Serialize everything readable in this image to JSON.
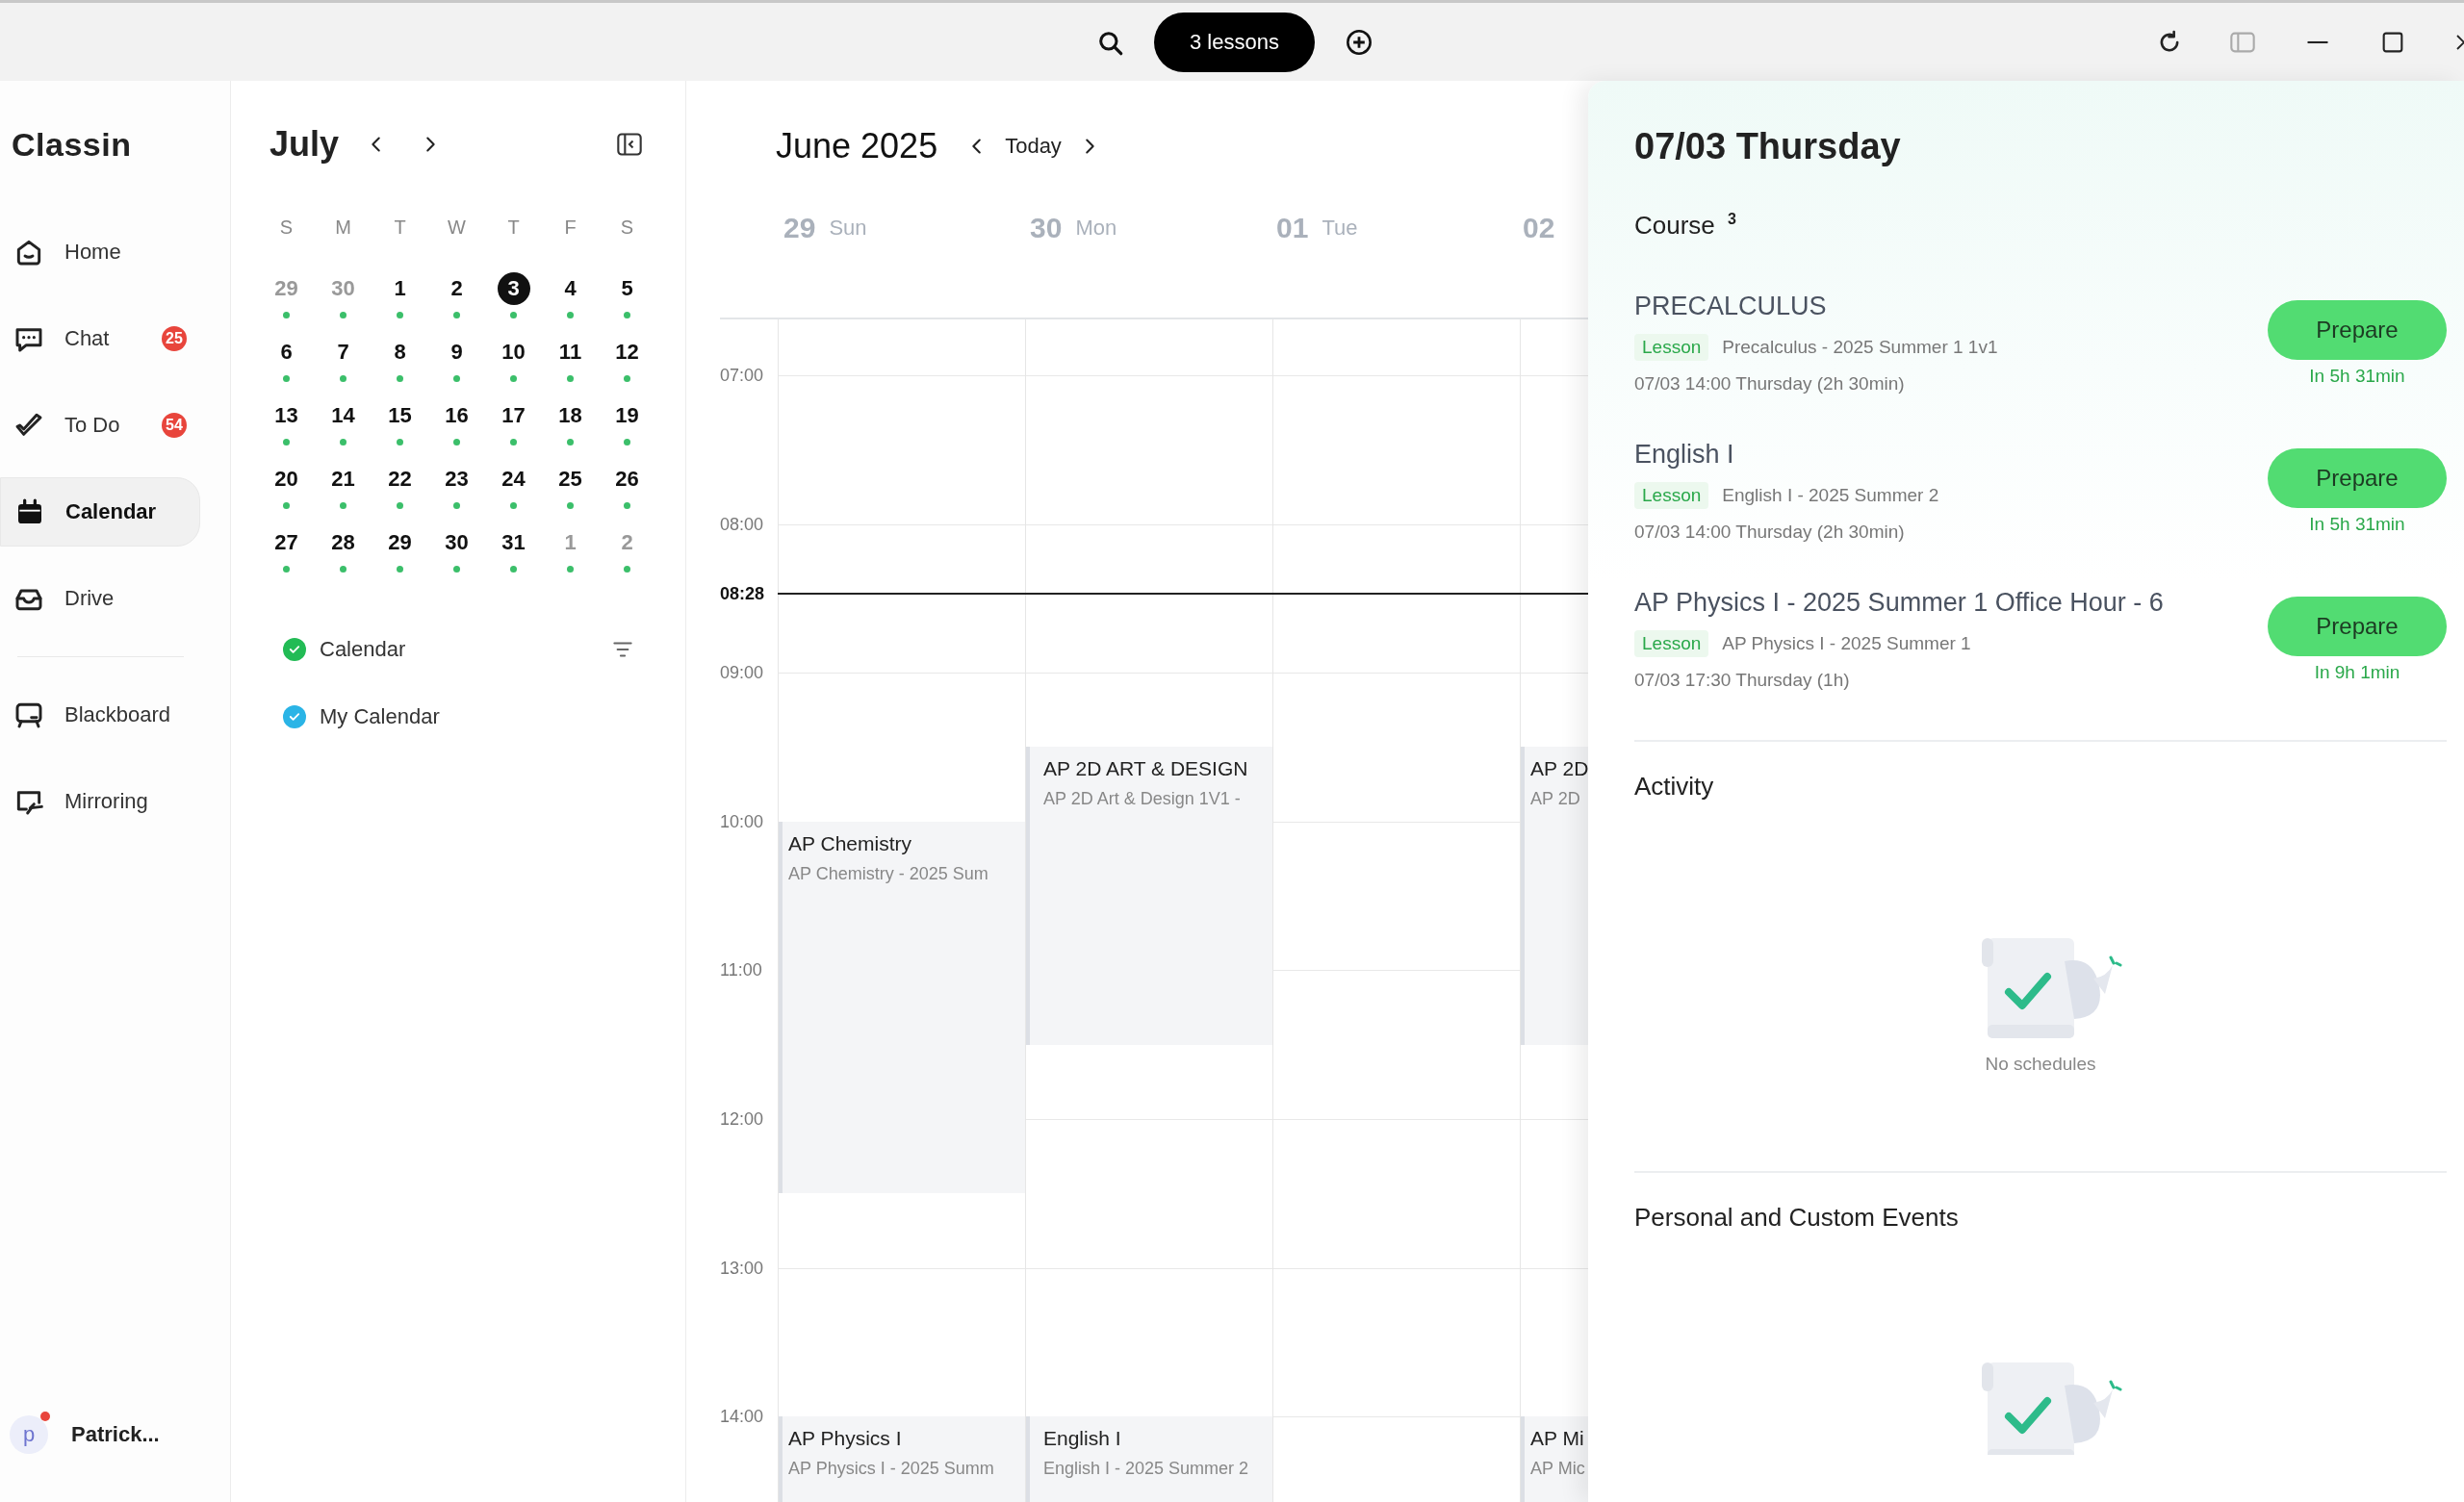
{
  "titlebar": {
    "lessons_button": "3 lessons"
  },
  "nav": {
    "logo": "Classin",
    "groups": [
      [
        {
          "kind": "home",
          "label": "Home",
          "selected": false
        },
        {
          "kind": "chat",
          "label": "Chat",
          "badge": "25",
          "selected": false
        },
        {
          "kind": "todo",
          "label": "To Do",
          "badge": "54",
          "selected": false
        },
        {
          "kind": "calendar",
          "label": "Calendar",
          "selected": true
        },
        {
          "kind": "drive",
          "label": "Drive",
          "selected": false
        }
      ],
      [
        {
          "kind": "blackboard",
          "label": "Blackboard",
          "selected": false
        },
        {
          "kind": "mirroring",
          "label": "Mirroring",
          "selected": false
        }
      ]
    ],
    "user": {
      "initial": "p",
      "name": "Patrick...",
      "notification": true
    }
  },
  "mini_calendar": {
    "month": "July",
    "weekdays": [
      "S",
      "M",
      "T",
      "W",
      "T",
      "F",
      "S"
    ],
    "weeks": [
      [
        {
          "label": "29",
          "muted": true,
          "selected": false,
          "event": true
        },
        {
          "label": "30",
          "muted": true,
          "selected": false,
          "event": true
        },
        {
          "label": "1",
          "muted": false,
          "selected": false,
          "event": true
        },
        {
          "label": "2",
          "muted": false,
          "selected": false,
          "event": true
        },
        {
          "label": "3",
          "muted": false,
          "selected": true,
          "event": true
        },
        {
          "label": "4",
          "muted": false,
          "selected": false,
          "event": true
        },
        {
          "label": "5",
          "muted": false,
          "selected": false,
          "event": true
        }
      ],
      [
        {
          "label": "6",
          "muted": false,
          "selected": false,
          "event": true
        },
        {
          "label": "7",
          "muted": false,
          "selected": false,
          "event": true
        },
        {
          "label": "8",
          "muted": false,
          "selected": false,
          "event": true
        },
        {
          "label": "9",
          "muted": false,
          "selected": false,
          "event": true
        },
        {
          "label": "10",
          "muted": false,
          "selected": false,
          "event": true
        },
        {
          "label": "11",
          "muted": false,
          "selected": false,
          "event": true
        },
        {
          "label": "12",
          "muted": false,
          "selected": false,
          "event": true
        }
      ],
      [
        {
          "label": "13",
          "muted": false,
          "selected": false,
          "event": true
        },
        {
          "label": "14",
          "muted": false,
          "selected": false,
          "event": true
        },
        {
          "label": "15",
          "muted": false,
          "selected": false,
          "event": true
        },
        {
          "label": "16",
          "muted": false,
          "selected": false,
          "event": true
        },
        {
          "label": "17",
          "muted": false,
          "selected": false,
          "event": true
        },
        {
          "label": "18",
          "muted": false,
          "selected": false,
          "event": true
        },
        {
          "label": "19",
          "muted": false,
          "selected": false,
          "event": true
        }
      ],
      [
        {
          "label": "20",
          "muted": false,
          "selected": false,
          "event": true
        },
        {
          "label": "21",
          "muted": false,
          "selected": false,
          "event": true
        },
        {
          "label": "22",
          "muted": false,
          "selected": false,
          "event": true
        },
        {
          "label": "23",
          "muted": false,
          "selected": false,
          "event": true
        },
        {
          "label": "24",
          "muted": false,
          "selected": false,
          "event": true
        },
        {
          "label": "25",
          "muted": false,
          "selected": false,
          "event": true
        },
        {
          "label": "26",
          "muted": false,
          "selected": false,
          "event": true
        }
      ],
      [
        {
          "label": "27",
          "muted": false,
          "selected": false,
          "event": true
        },
        {
          "label": "28",
          "muted": false,
          "selected": false,
          "event": true
        },
        {
          "label": "29",
          "muted": false,
          "selected": false,
          "event": true
        },
        {
          "label": "30",
          "muted": false,
          "selected": false,
          "event": true
        },
        {
          "label": "31",
          "muted": false,
          "selected": false,
          "event": true
        },
        {
          "label": "1",
          "muted": true,
          "selected": false,
          "event": true
        },
        {
          "label": "2",
          "muted": true,
          "selected": false,
          "event": true
        }
      ]
    ],
    "calendars": [
      {
        "label": "Calendar",
        "checked": true,
        "color": "#22bb55"
      },
      {
        "label": "My Calendar",
        "checked": true,
        "color": "#2ab4e6"
      }
    ]
  },
  "week": {
    "title": "June 2025",
    "today_button": "Today",
    "hours": [
      "07:00",
      "08:00",
      "09:00",
      "10:00",
      "11:00",
      "12:00",
      "13:00",
      "14:00"
    ],
    "now": "08:28",
    "days": [
      {
        "number": "29",
        "weekday": "Sun",
        "events": [
          {
            "title": "AP Chemistry",
            "subtitle": "AP Chemistry - 2025 Sum"
          },
          {
            "title": "AP Physics I",
            "subtitle": "AP Physics I - 2025 Summ"
          }
        ]
      },
      {
        "number": "30",
        "weekday": "Mon",
        "events": [
          {
            "title": "AP 2D ART & DESIGN",
            "subtitle": "AP 2D Art & Design 1V1 -"
          },
          {
            "title": "English I",
            "subtitle": "English I - 2025 Summer 2"
          }
        ]
      },
      {
        "number": "01",
        "weekday": "Tue"
      },
      {
        "number": "02",
        "events": [
          {
            "title": "AP 2D",
            "subtitle": "AP 2D"
          },
          {
            "title": "AP Mi",
            "subtitle": "AP Mic"
          }
        ]
      }
    ]
  },
  "day_panel": {
    "title": "07/03 Thursday",
    "course_heading": "Course $^{3}$",
    "courses": [
      {
        "title": "PRECALCULUS",
        "tag": "Lesson",
        "subtitle": "Precalculus - 2025 Summer 1 1v1",
        "time": "07/03 14:00 Thursday (2h 30min)",
        "button": "Prepare",
        "countdown": "In 5h 31min"
      },
      {
        "title": "English I",
        "tag": "Lesson",
        "subtitle": "English I - 2025 Summer 2",
        "time": "07/03 14:00 Thursday (2h 30min)",
        "button": "Prepare",
        "countdown": "In 5h 31min"
      },
      {
        "title": "AP Physics I - 2025 Summer 1 Office Hour - 6",
        "tag": "Lesson",
        "subtitle": "AP Physics I - 2025 Summer 1",
        "time": "07/03 17:30 Thursday (1h)",
        "button": "Prepare",
        "countdown": "In 9h 1min"
      }
    ],
    "activity": {
      "title": "Activity",
      "empty_text": "No schedules"
    },
    "personal": {
      "title": "Personal and Custom Events"
    }
  }
}
